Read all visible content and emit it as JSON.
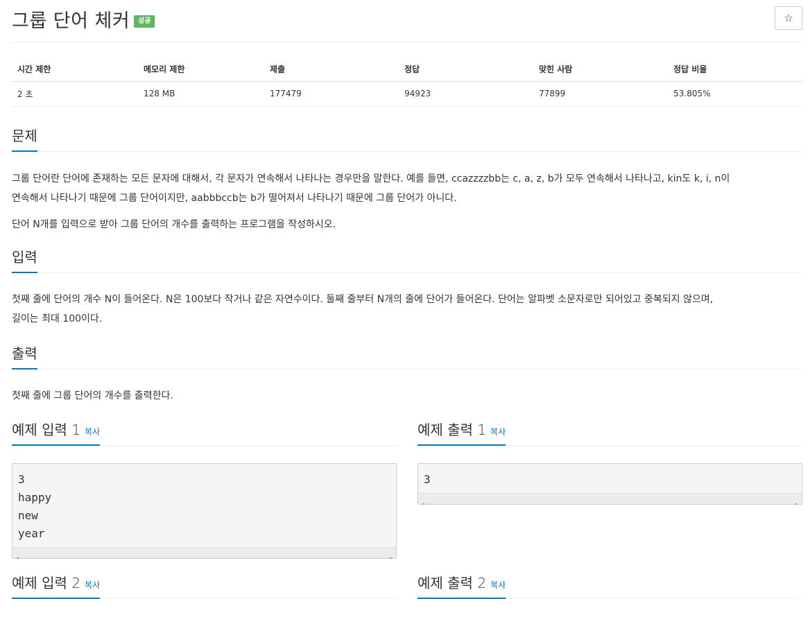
{
  "problem": {
    "title": "그룹 단어 체커",
    "status_badge": "성공",
    "star_icon": "☆"
  },
  "stats": {
    "headers": [
      "시간 제한",
      "메모리 제한",
      "제출",
      "정답",
      "맞힌 사람",
      "정답 비율"
    ],
    "values": [
      "2 초",
      "128 MB",
      "177479",
      "94923",
      "77899",
      "53.805%"
    ]
  },
  "sections": {
    "description": {
      "title": "문제",
      "p1_line1": "그룹 단어란 단어에 존재하는 모든 문자에 대해서, 각 문자가 연속해서 나타나는 경우만을 말한다. 예를 들면, ccazzzzbb는 c, a, z, b가 모두 연속해서 나타나고, kin도 k, i, n이",
      "p1_line2": "연속해서 나타나기 때문에 그룹 단어이지만, aabbbccb는 b가 떨어져서 나타나기 때문에 그룹 단어가 아니다.",
      "p2": "단어 N개를 입력으로 받아 그룹 단어의 개수를 출력하는 프로그램을 작성하시오."
    },
    "input": {
      "title": "입력",
      "line1": "첫째 줄에 단어의 개수 N이 들어온다. N은 100보다 작거나 같은 자연수이다. 둘째 줄부터 N개의 줄에 단어가 들어온다. 단어는 알파벳 소문자로만 되어있고 중복되지 않으며,",
      "line2": "길이는 최대 100이다."
    },
    "output": {
      "title": "출력",
      "line1": "첫째 줄에 그룹 단어의 개수를 출력한다."
    }
  },
  "samples": {
    "copy_label": "복사",
    "input1": {
      "title": "예제 입력 1",
      "lines": [
        "3",
        "happy",
        "new",
        "year"
      ]
    },
    "output1": {
      "title": "예제 출력 1",
      "lines": [
        "3"
      ]
    },
    "input2": {
      "title": "예제 입력 2"
    },
    "output2": {
      "title": "예제 출력 2"
    }
  }
}
